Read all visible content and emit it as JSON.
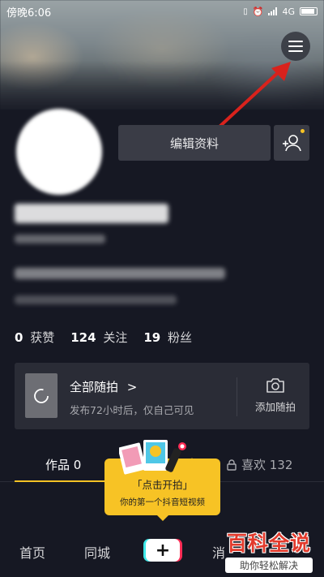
{
  "status_bar": {
    "time": "傍晚6:06",
    "network": "4G"
  },
  "profile": {
    "edit_label": "编辑资料",
    "stats": [
      {
        "value": "0",
        "label": "获赞"
      },
      {
        "value": "124",
        "label": "关注"
      },
      {
        "value": "19",
        "label": "粉丝"
      }
    ]
  },
  "album": {
    "title": "全部随拍",
    "chevron": ">",
    "subtitle": "发布72小时后，仅自己可见",
    "add_label": "添加随拍"
  },
  "tabs": {
    "works": "作品 0",
    "likes": "喜欢 132"
  },
  "popup": {
    "title": "「点击开拍」",
    "subtitle": "你的第一个抖音短视频"
  },
  "bottom_nav": {
    "home": "首页",
    "nearby": "同城",
    "plus": "+",
    "messages_partial": "消"
  },
  "watermark": {
    "title": "百科全说",
    "subtitle": "助你轻松解决"
  },
  "colors": {
    "accent": "#f7c325",
    "background": "#161823",
    "annotation": "#d9221c"
  }
}
